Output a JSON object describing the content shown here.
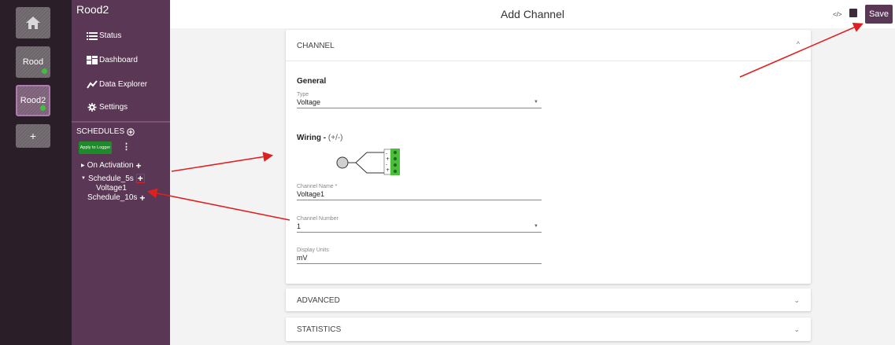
{
  "rail": {
    "home_icon": "home-icon",
    "items": [
      {
        "label": "Rood",
        "status_color": "#3cc13c"
      },
      {
        "label": "Rood2",
        "status_color": "#3cc13c"
      }
    ],
    "add_label": "+"
  },
  "sidebar": {
    "title": "Rood2",
    "nav": [
      {
        "label": "Status",
        "icon": "list-icon"
      },
      {
        "label": "Dashboard",
        "icon": "dashboard-icon"
      },
      {
        "label": "Data Explorer",
        "icon": "chart-line-icon"
      },
      {
        "label": "Settings",
        "icon": "gear-icon"
      }
    ],
    "schedules_label": "SCHEDULES",
    "apply_label": "Apply to Logger",
    "tree": {
      "on_activation": "On Activation",
      "schedule_5s": "Schedule_5s",
      "voltage1": "Voltage1",
      "schedule_10s": "Schedule_10s"
    }
  },
  "header": {
    "title": "Add Channel",
    "save_label": "Save"
  },
  "channel_panel": {
    "heading": "CHANNEL",
    "general_title": "General",
    "type_label": "Type",
    "type_value": "Voltage",
    "wiring_title": "Wiring - ",
    "wiring_hint": "(+/-)",
    "channel_name_label": "Channel Name *",
    "channel_name_value": "Voltage1",
    "channel_number_label": "Channel Number",
    "channel_number_value": "1",
    "display_units_label": "Display Units",
    "display_units_value": "mV"
  },
  "advanced_panel": {
    "heading": "ADVANCED"
  },
  "statistics_panel": {
    "heading": "STATISTICS"
  },
  "colors": {
    "sidebar": "#5a3755",
    "accent_green": "#1e8a2a",
    "annotation_red": "#e02020"
  }
}
